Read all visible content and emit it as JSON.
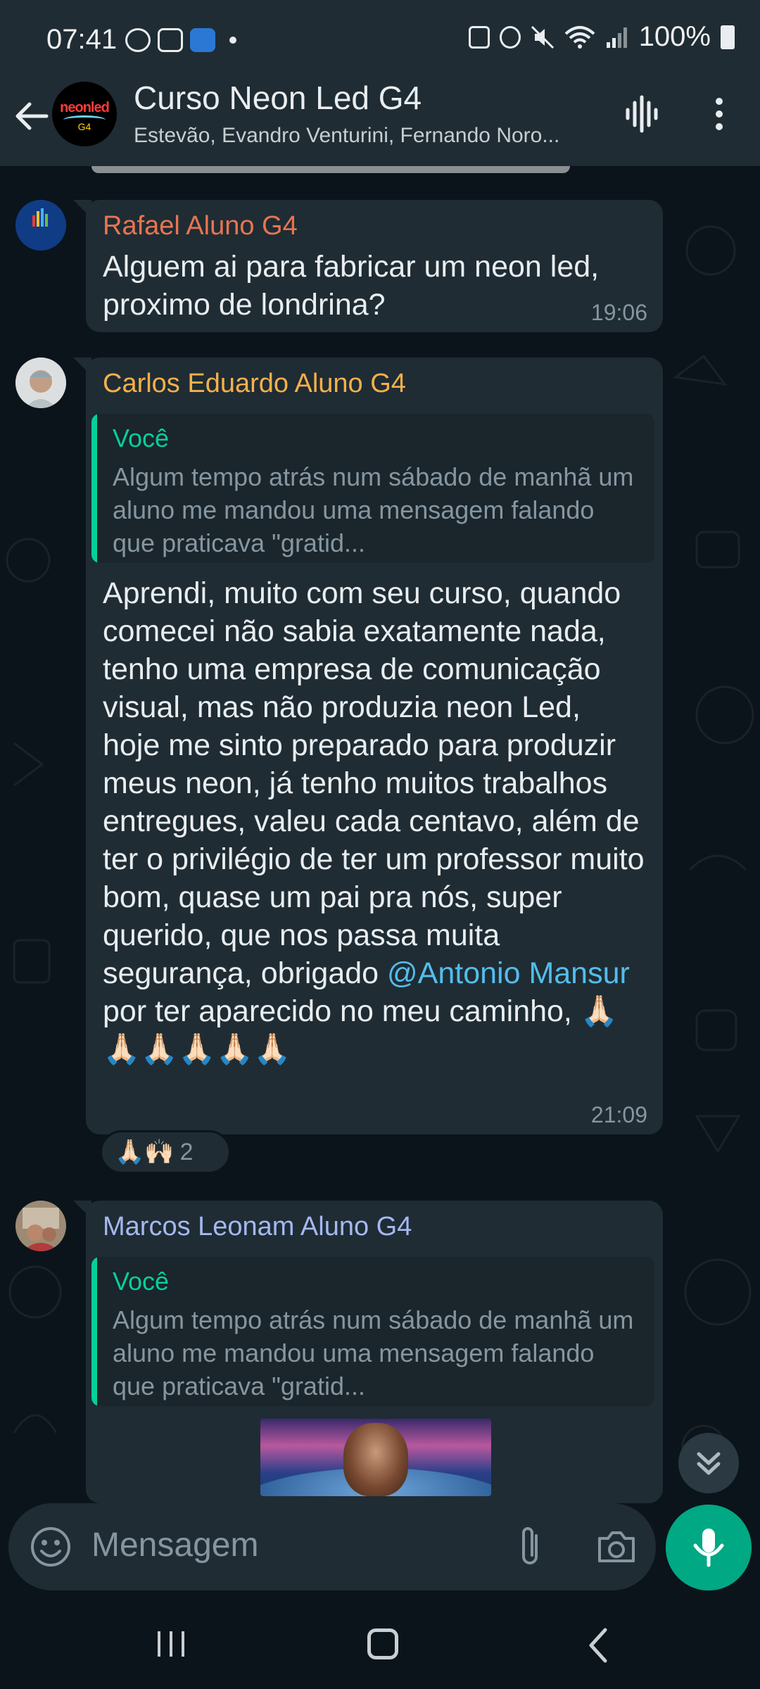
{
  "status_bar": {
    "time": "07:41",
    "battery": "100%"
  },
  "header": {
    "title": "Curso Neon Led G4",
    "subtitle": "Estevão, Evandro Venturini, Fernando Noro...",
    "avatar_text": "neonled",
    "avatar_sub": "G4"
  },
  "messages": [
    {
      "sender": "Rafael Aluno G4",
      "sender_color": "#e8754f",
      "text": "Alguem ai para fabricar um neon led, proximo de londrina?",
      "time": "19:06"
    },
    {
      "sender": "Carlos Eduardo Aluno G4",
      "sender_color": "#f6b04a",
      "quote_sender": "Você",
      "quote_text": "Algum tempo atrás num sábado de manhã um aluno me mandou uma mensagem falando que praticava \"gratid...",
      "text_before_mention": "Aprendi, muito com seu curso, quando comecei não sabia exatamente nada, tenho uma empresa de comunicação visual, mas não produzia neon Led, hoje me sinto preparado para produzir meus neon, já tenho muitos trabalhos entregues, valeu cada centavo, além de ter o privilégio de ter um professor muito bom, quase um pai pra nós, super querido, que nos passa muita segurança, obrigado ",
      "mention": "@Antonio Mansur",
      "text_after_mention": " por ter aparecido no meu caminho, 🙏🏻🙏🏻🙏🏻🙏🏻🙏🏻🙏🏻",
      "time": "21:09",
      "reactions": "🙏🏻🙌🏻",
      "reaction_count": "2"
    },
    {
      "sender": "Marcos Leonam Aluno G4",
      "sender_color": "#a5b8f0",
      "quote_sender": "Você",
      "quote_text": "Algum tempo atrás num sábado de manhã um aluno me mandou uma mensagem falando que praticava \"gratid..."
    }
  ],
  "input": {
    "placeholder": "Mensagem"
  },
  "colors": {
    "accent": "#00a884",
    "bubble": "#1f2c34",
    "background": "#0b141a",
    "quote_accent": "#06cf9c",
    "mention": "#53bdeb"
  }
}
